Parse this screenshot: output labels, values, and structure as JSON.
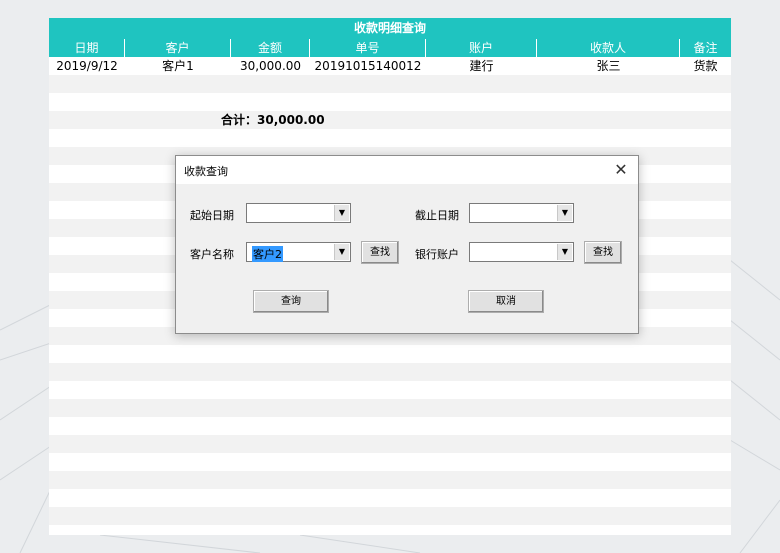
{
  "sheet": {
    "title": "收款明细查询",
    "columns": [
      "日期",
      "客户",
      "金额",
      "单号",
      "账户",
      "收款人",
      "备注"
    ],
    "row": [
      "2019/9/12",
      "客户1",
      "30,000.00",
      "20191015140012",
      "建行",
      "张三",
      "货款"
    ],
    "total": "合计：30,000.00"
  },
  "dialog": {
    "title": "收款查询",
    "close_glyph": "✕",
    "start_date_label": "起始日期",
    "end_date_label": "截止日期",
    "customer_label": "客户名称",
    "customer_value": "客户2",
    "bank_label": "银行账户",
    "find_label": "查找",
    "query_label": "查询",
    "cancel_label": "取消",
    "dropdown_glyph": "▼"
  },
  "colors": {
    "accent": "#1fc4c0",
    "stripe": "#f2f2f2"
  }
}
